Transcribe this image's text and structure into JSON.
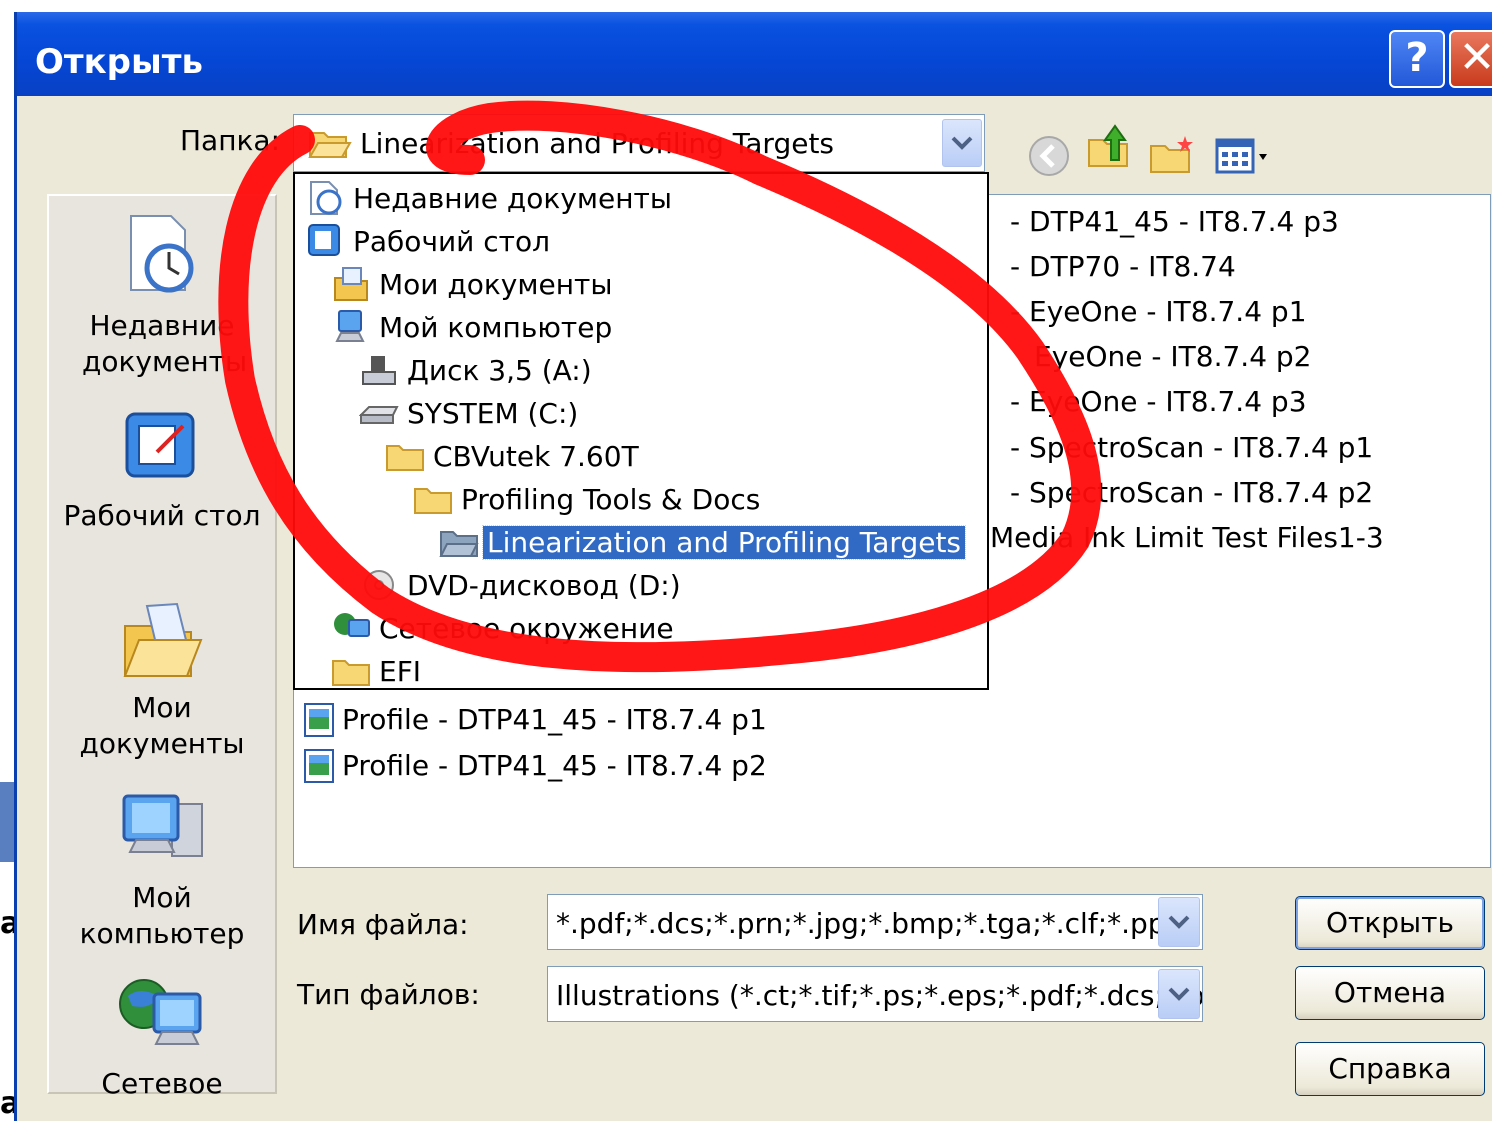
{
  "window": {
    "title": "Открыть",
    "help_glyph": "?",
    "close_glyph": "✕"
  },
  "folder_bar": {
    "label": "Папка:",
    "current": "Linearization and Profiling Targets"
  },
  "toolbar": {
    "icons": [
      "back-icon",
      "up-folder-icon",
      "new-folder-icon",
      "view-menu-icon"
    ]
  },
  "places": [
    {
      "label": "Недавние документы",
      "icon": "recent-documents-icon"
    },
    {
      "label": "Рабочий стол",
      "icon": "desktop-icon"
    },
    {
      "label": "Мои документы",
      "icon": "my-documents-icon"
    },
    {
      "label": "Мой компьютер",
      "icon": "my-computer-icon"
    },
    {
      "label": "Сетевое",
      "icon": "network-icon"
    }
  ],
  "dropdown": {
    "items": [
      {
        "label": "Недавние документы",
        "icon": "recent-documents-icon"
      },
      {
        "label": "Рабочий стол",
        "icon": "desktop-icon"
      },
      {
        "label": "Мои документы",
        "icon": "my-documents-icon"
      },
      {
        "label": "Мой компьютер",
        "icon": "my-computer-icon"
      },
      {
        "label": "Диск 3,5 (A:)",
        "icon": "floppy-drive-icon"
      },
      {
        "label": "SYSTEM (C:)",
        "icon": "hard-drive-icon"
      },
      {
        "label": "CBVutek 7.60T",
        "icon": "folder-icon"
      },
      {
        "label": "Profiling Tools & Docs",
        "icon": "folder-icon"
      },
      {
        "label": "Linearization and Profiling Targets",
        "icon": "open-folder-icon",
        "selected": true
      },
      {
        "label": "DVD-дисковод (D:)",
        "icon": "dvd-drive-icon"
      },
      {
        "label": "Сетевое окружение",
        "icon": "network-icon"
      },
      {
        "label": "EFI",
        "icon": "folder-icon"
      }
    ]
  },
  "files": {
    "right_column": [
      "-  DTP41_45 - IT8.7.4 p3",
      "-  DTP70 - IT8.74",
      "-  EyeOne - IT8.7.4 p1",
      "EyeOne - IT8.7.4 p2",
      "-  EyeOne - IT8.7.4 p3",
      "-  SpectroScan - IT8.7.4 p1",
      "-  SpectroScan - IT8.7.4 p2",
      "Media Ink Limit Test Files1-3"
    ],
    "left_column": [
      "Profile  -  DTP41_45 - IT8.7.4 p1",
      "Profile  -  DTP41_45 - IT8.7.4 p2"
    ]
  },
  "form": {
    "filename_label": "Имя файла:",
    "filename_value": "*.pdf;*.dcs;*.prn;*.jpg;*.bmp;*.tga;*.clf;*.ppm;*.rtl",
    "filetype_label": "Тип файлов:",
    "filetype_value": "Illustrations (*.ct;*.tif;*.ps;*.eps;*.pdf;*.dcs;*.prn;*"
  },
  "buttons": {
    "open": "Открыть",
    "cancel": "Отмена",
    "help": "Справка"
  },
  "background": {
    "glyph": "a"
  },
  "colors": {
    "title_bar": "#0a52e0",
    "selection": "#316ac5",
    "annotation": "#ff0000",
    "dialog_bg": "#ece9d8"
  }
}
